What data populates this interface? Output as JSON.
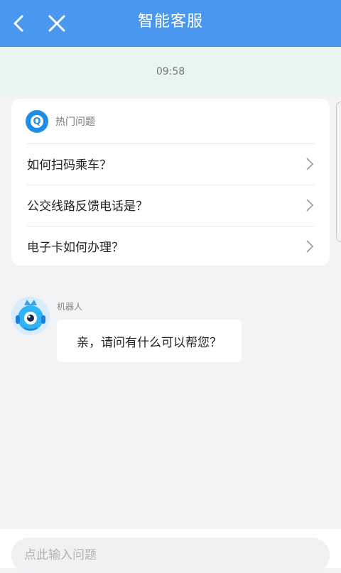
{
  "header": {
    "title": "智能客服",
    "back_icon": "chevron-left-icon",
    "close_icon": "close-icon",
    "color": "#4a97f0"
  },
  "timestamp": "09:58",
  "hot_questions": {
    "title": "热门问题",
    "icon": "q-logo-icon",
    "items": [
      {
        "label": "如何扫码乘车？"
      },
      {
        "label": "公交线路反馈电话是？"
      },
      {
        "label": "电子卡如何办理？"
      }
    ]
  },
  "chat": {
    "sender": "机器人",
    "message": "亲，请问有什么可以帮您？",
    "avatar_icon": "robot-avatar-icon"
  },
  "input": {
    "placeholder": "点此输入问题",
    "value": ""
  }
}
